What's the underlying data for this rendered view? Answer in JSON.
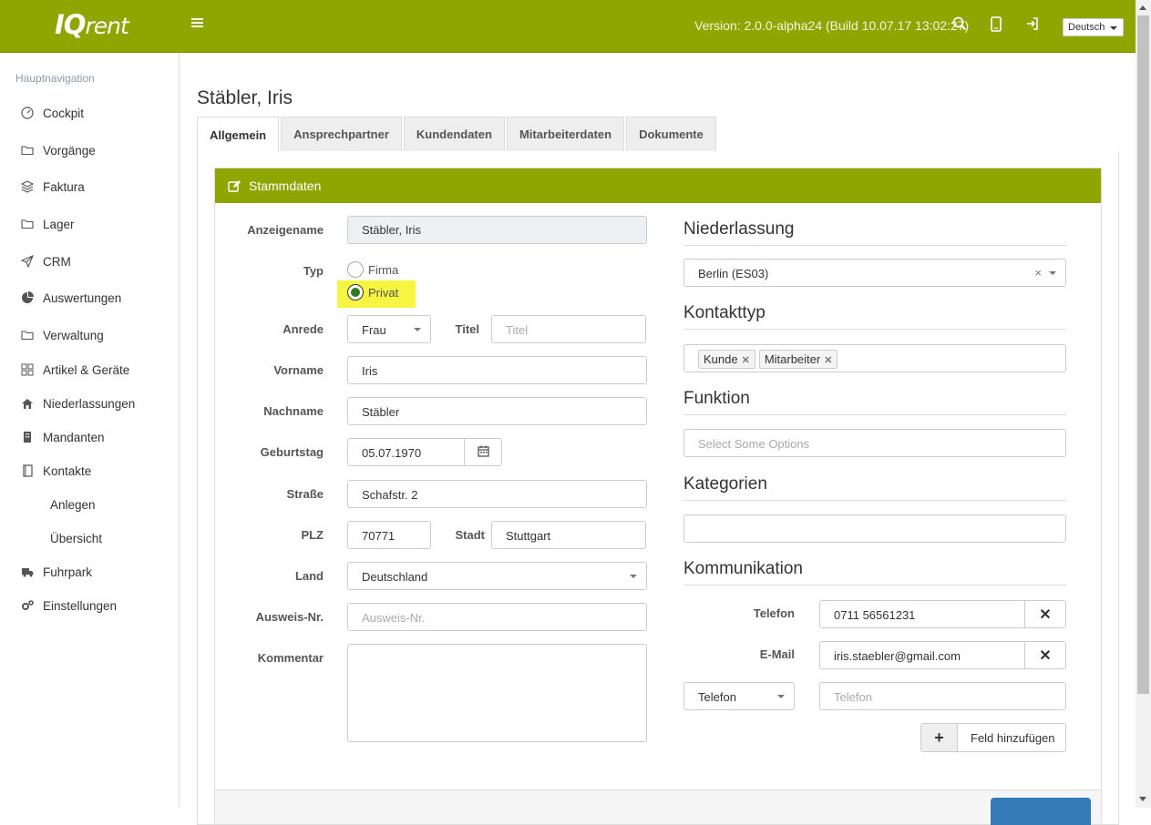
{
  "topbar": {
    "logo_iq": "IQ",
    "logo_rent": "rent",
    "version": "Version: 2.0.0-alpha24 (Build 10.07.17 13:02:27)",
    "language": "Deutsch",
    "brand_color": "#8fa500"
  },
  "sidebar": {
    "heading": "Hauptnavigation",
    "items": [
      {
        "label": "Cockpit",
        "icon": "dashboard-icon"
      },
      {
        "label": "Vorgänge",
        "icon": "folder-icon"
      },
      {
        "label": "Faktura",
        "icon": "layers-icon"
      },
      {
        "label": "Lager",
        "icon": "folder-icon"
      },
      {
        "label": "CRM",
        "icon": "paper-plane-icon"
      },
      {
        "label": "Auswertungen",
        "icon": "pie-chart-icon"
      },
      {
        "label": "Verwaltung",
        "icon": "folder-icon"
      },
      {
        "label": "Artikel & Geräte",
        "icon": "grid-icon"
      },
      {
        "label": "Niederlassungen",
        "icon": "home-icon"
      },
      {
        "label": "Mandanten",
        "icon": "building-icon"
      },
      {
        "label": "Kontakte",
        "icon": "book-icon"
      },
      {
        "label": "Anlegen",
        "icon": ""
      },
      {
        "label": "Übersicht",
        "icon": ""
      },
      {
        "label": "Fuhrpark",
        "icon": "truck-icon"
      },
      {
        "label": "Einstellungen",
        "icon": "cogs-icon"
      }
    ]
  },
  "page": {
    "title": "Stäbler, Iris",
    "tabs": [
      "Allgemein",
      "Ansprechpartner",
      "Kundendaten",
      "Mitarbeiterdaten",
      "Dokumente"
    ],
    "active_tab": "Allgemein"
  },
  "form": {
    "panel_title": "Stammdaten",
    "anzeigename_label": "Anzeigename",
    "anzeigename_value": "Stäbler, Iris",
    "typ_label": "Typ",
    "typ_options": [
      "Firma",
      "Privat"
    ],
    "typ_selected": "Privat",
    "anrede_label": "Anrede",
    "anrede_value": "Frau",
    "titel_label": "Titel",
    "titel_placeholder": "Titel",
    "vorname_label": "Vorname",
    "vorname_value": "Iris",
    "nachname_label": "Nachname",
    "nachname_value": "Stäbler",
    "geburtstag_label": "Geburtstag",
    "geburtstag_value": "05.07.1970",
    "strasse_label": "Straße",
    "strasse_value": "Schafstr. 2",
    "plz_label": "PLZ",
    "plz_value": "70771",
    "stadt_label": "Stadt",
    "stadt_value": "Stuttgart",
    "land_label": "Land",
    "land_value": "Deutschland",
    "ausweis_label": "Ausweis-Nr.",
    "ausweis_placeholder": "Ausweis-Nr.",
    "kommentar_label": "Kommentar",
    "kommentar_value": ""
  },
  "right": {
    "niederlassung_heading": "Niederlassung",
    "niederlassung_value": "Berlin (ES03)",
    "kontakttyp_heading": "Kontakttyp",
    "kontakttyp_tags": [
      "Kunde",
      "Mitarbeiter"
    ],
    "funktion_heading": "Funktion",
    "funktion_placeholder": "Select Some Options",
    "kategorien_heading": "Kategorien",
    "kommunikation_heading": "Kommunikation",
    "comm_rows": [
      {
        "label": "Telefon",
        "value": "0711 56561231"
      },
      {
        "label": "E-Mail",
        "value": "iris.staebler@gmail.com"
      }
    ],
    "new_type": "Telefon",
    "new_placeholder": "Telefon",
    "add_field_label": "Feld hinzufügen"
  }
}
